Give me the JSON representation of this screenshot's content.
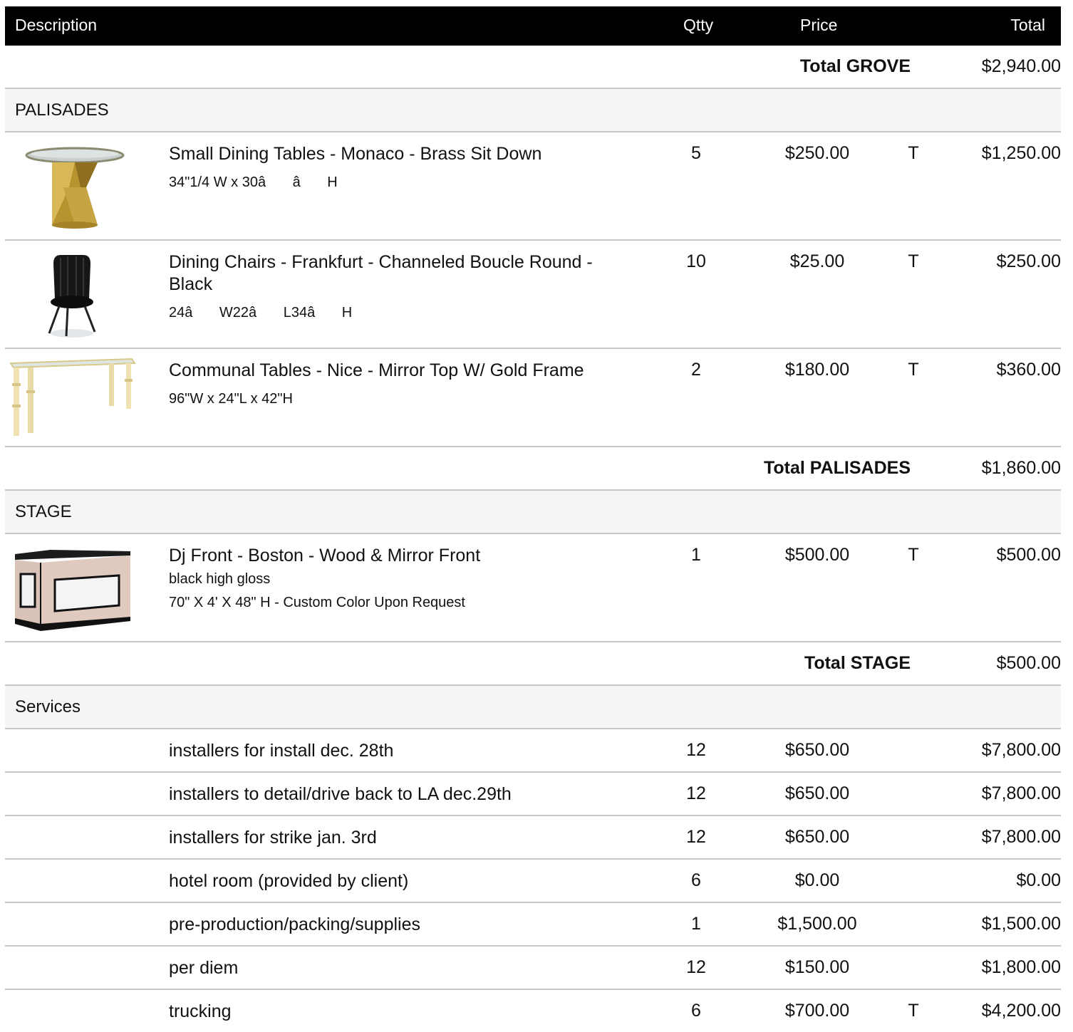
{
  "header": {
    "description": "Description",
    "qty": "Qtty",
    "price": "Price",
    "total": "Total"
  },
  "grove_total": {
    "label": "Total GROVE",
    "amount": "$2,940.00"
  },
  "palisades": {
    "name": "PALISADES",
    "items": [
      {
        "title": "Small Dining Tables - Monaco - Brass Sit Down",
        "sub": "34\"1/4 W x 30â â H",
        "qty": "5",
        "price": "$250.00",
        "tax": "T",
        "total": "$1,250.00",
        "icon": "brass-table-image"
      },
      {
        "title": "Dining Chairs - Frankfurt - Channeled Boucle Round - Black",
        "sub": "24â W22â L34â H",
        "qty": "10",
        "price": "$25.00",
        "tax": "T",
        "total": "$250.00",
        "icon": "black-chair-image"
      },
      {
        "title": "Communal Tables - Nice - Mirror Top W/ Gold Frame",
        "sub": "96\"W x 24\"L x 42\"H",
        "qty": "2",
        "price": "$180.00",
        "tax": "T",
        "total": "$360.00",
        "icon": "communal-table-image"
      }
    ],
    "total_label": "Total PALISADES",
    "total_amount": "$1,860.00"
  },
  "stage": {
    "name": "STAGE",
    "item": {
      "title": "Dj Front - Boston - Wood & Mirror Front",
      "sub1": "black high gloss",
      "sub2": "70\" X 4' X 48\" H - Custom Color Upon Request",
      "qty": "1",
      "price": "$500.00",
      "tax": "T",
      "total": "$500.00",
      "icon": "dj-front-image"
    },
    "total_label": "Total STAGE",
    "total_amount": "$500.00"
  },
  "services": {
    "name": "Services",
    "rows": [
      {
        "desc": "installers for install dec. 28th",
        "qty": "12",
        "price": "$650.00",
        "tax": "",
        "total": "$7,800.00"
      },
      {
        "desc": "installers to detail/drive back to LA dec.29th",
        "qty": "12",
        "price": "$650.00",
        "tax": "",
        "total": "$7,800.00"
      },
      {
        "desc": "installers for strike jan. 3rd",
        "qty": "12",
        "price": "$650.00",
        "tax": "",
        "total": "$7,800.00"
      },
      {
        "desc": "hotel room (provided by client)",
        "qty": "6",
        "price": "$0.00",
        "tax": "",
        "total": "$0.00"
      },
      {
        "desc": "pre-production/packing/supplies",
        "qty": "1",
        "price": "$1,500.00",
        "tax": "",
        "total": "$1,500.00"
      },
      {
        "desc": "per diem",
        "qty": "12",
        "price": "$150.00",
        "tax": "",
        "total": "$1,800.00"
      },
      {
        "desc": "trucking",
        "qty": "6",
        "price": "$700.00",
        "tax": "T",
        "total": "$4,200.00"
      }
    ]
  }
}
